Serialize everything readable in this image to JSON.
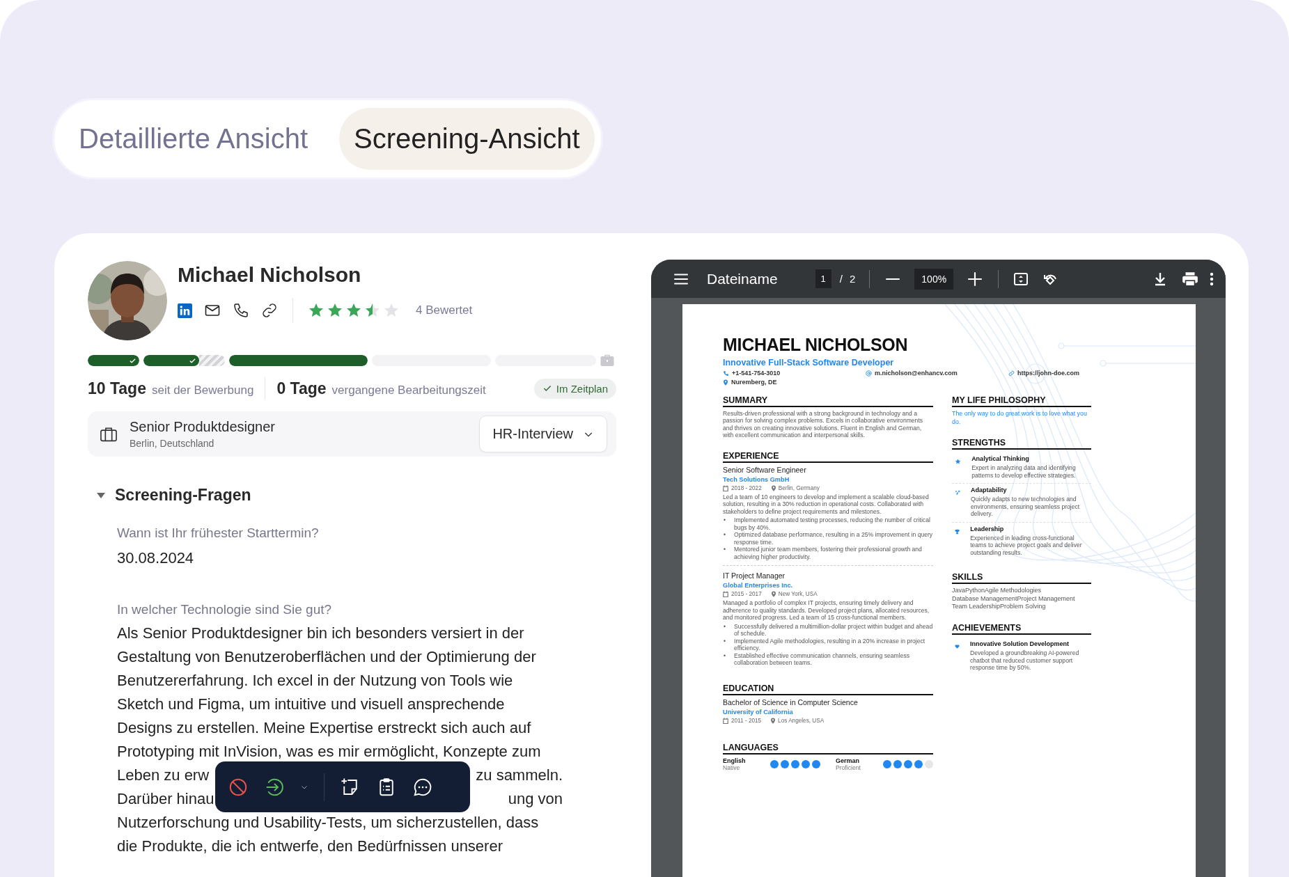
{
  "view_toggle": [
    {
      "label": "Detaillierte Ansicht",
      "selected": false
    },
    {
      "label": "Screening-Ansicht",
      "selected": true
    }
  ],
  "candidate": {
    "name": "Michael Nicholson",
    "rating": {
      "stars": 3.5,
      "label": "4 Bewertet"
    }
  },
  "pipeline": [
    {
      "kind": "done"
    },
    {
      "kind": "partial"
    },
    {
      "kind": "current"
    },
    {
      "kind": "pending"
    },
    {
      "kind": "pending"
    }
  ],
  "stats": [
    {
      "value": "10 Tage",
      "label": "seit der Bewerbung"
    },
    {
      "value": "0 Tage",
      "label": "vergangene Bearbeitungszeit"
    }
  ],
  "status_badge": "Im Zeitplan",
  "job": {
    "title": "Senior Produktdesigner",
    "location": "Berlin, Deutschland",
    "stage": "HR-Interview"
  },
  "screening": {
    "title": "Screening-Fragen",
    "expanded": true,
    "questions": [
      {
        "question": "Wann ist Ihr frühester Starttermin?",
        "answer_lines": [
          [
            "30.08.2024"
          ]
        ]
      },
      {
        "question": "In welcher Technologie sind Sie gut?",
        "answer_lines": [
          [
            "Als Senior Produktdesigner bin ich besonders versiert in der"
          ],
          [
            "Gestaltung von Benutzeroberflächen und der Optimierung der"
          ],
          [
            "Benutzererfahrung. Ich excel in der Nutzung von Tools wie"
          ],
          [
            "Sketch und Figma, um intuitive und visuell ansprechende"
          ],
          [
            "Designs zu erstellen. Meine Expertise erstreckt sich auch auf"
          ],
          [
            "Prototyping mit InVision, was es mir ermöglicht, Konzepte zum"
          ],
          [
            "Leben zu erw",
            "zu sammeln."
          ],
          [
            "Darüber hinau",
            "ung von"
          ],
          [
            "Nutzerforschung und Usability-Tests, um sicherzustellen, dass"
          ],
          [
            "die Produkte, die ich entwerfe, den Bedürfnissen unserer"
          ]
        ]
      }
    ]
  },
  "pdf_viewer": {
    "filename": "Dateiname",
    "page": "1",
    "page_separator": "/",
    "page_count": "2",
    "zoom": "100%"
  },
  "resume": {
    "name": "MICHAEL NICHOLSON",
    "headline": "Innovative Full-Stack Software Developer",
    "contacts": [
      {
        "kind": "phone",
        "text": "+1-541-754-3010"
      },
      {
        "kind": "email",
        "text": "m.nicholson@enhancv.com"
      },
      {
        "kind": "link",
        "text": "https://john-doe.com"
      },
      {
        "kind": "location",
        "text": "Nuremberg, DE"
      }
    ],
    "summary": {
      "title": "SUMMARY",
      "text": "Results-driven professional with a strong background in technology and a passion for solving complex problems. Excels in collaborative environments and thrives on creating innovative solutions. Fluent in English and German, with excellent communication and interpersonal skills."
    },
    "experience": {
      "title": "EXPERIENCE",
      "bullet_marker": "•",
      "entries": [
        {
          "role": "Senior Software Engineer",
          "org": "Tech Solutions GmbH",
          "dates": "2018 - 2022",
          "place": "Berlin, Germany",
          "text": "Led a team of 10 engineers to develop and implement a scalable cloud-based solution, resulting in a 30% reduction in operational costs. Collaborated with stakeholders to define project requirements and milestones.",
          "bullets": [
            "Implemented automated testing processes, reducing the number of critical bugs by 40%.",
            "Optimized database performance, resulting in a 25% improvement in query response time.",
            "Mentored junior team members, fostering their professional growth and achieving higher productivity."
          ]
        },
        {
          "role": "IT Project Manager",
          "org": "Global Enterprises Inc.",
          "dates": "2015 - 2017",
          "place": "New York, USA",
          "text": "Managed a portfolio of complex IT projects, ensuring timely delivery and adherence to quality standards. Developed project plans, allocated resources, and monitored progress. Led a team of 15 cross-functional members.",
          "bullets": [
            "Successfully delivered a multimillion-dollar project within budget and ahead of schedule.",
            "Implemented Agile methodologies, resulting in a 20% increase in project efficiency.",
            "Established effective communication channels, ensuring seamless collaboration between teams."
          ]
        }
      ]
    },
    "education": {
      "title": "EDUCATION",
      "entries": [
        {
          "role": "Bachelor of Science in Computer Science",
          "org": "University of California",
          "dates": "2011 - 2015",
          "place": "Los Angeles, USA"
        }
      ]
    },
    "languages": {
      "title": "LANGUAGES",
      "items": [
        {
          "name": "English",
          "level_label": "Native",
          "stars": 5
        },
        {
          "name": "German",
          "level_label": "Proficient",
          "stars": 4
        }
      ]
    },
    "philosophy": {
      "title": "MY LIFE PHILOSOPHY",
      "text": "The only way to do great work is to love what you do."
    },
    "strengths": {
      "title": "STRENGTHS",
      "items": [
        {
          "kind": "star",
          "title": "Analytical Thinking",
          "text": "Expert in analyzing data and identifying patterns to develop effective strategies."
        },
        {
          "kind": "arrow",
          "title": "Adaptability",
          "text": "Quickly adapts to new technologies and environments, ensuring seamless project delivery."
        },
        {
          "kind": "trophy",
          "title": "Leadership",
          "text": "Experienced in leading cross-functional teams to achieve project goals and deliver outstanding results."
        }
      ]
    },
    "skills": {
      "title": "SKILLS",
      "lines": [
        "JavaPythonAgile Methodologies",
        "Database ManagementProject Management",
        "Team LeadershipProblem Solving"
      ]
    },
    "achievements": {
      "title": "ACHIEVEMENTS",
      "items": [
        {
          "kind": "heart",
          "title": "Innovative Solution Development",
          "text": "Developed a groundbreaking AI-powered chatbot that reduced customer support response time by 50%."
        }
      ]
    }
  }
}
